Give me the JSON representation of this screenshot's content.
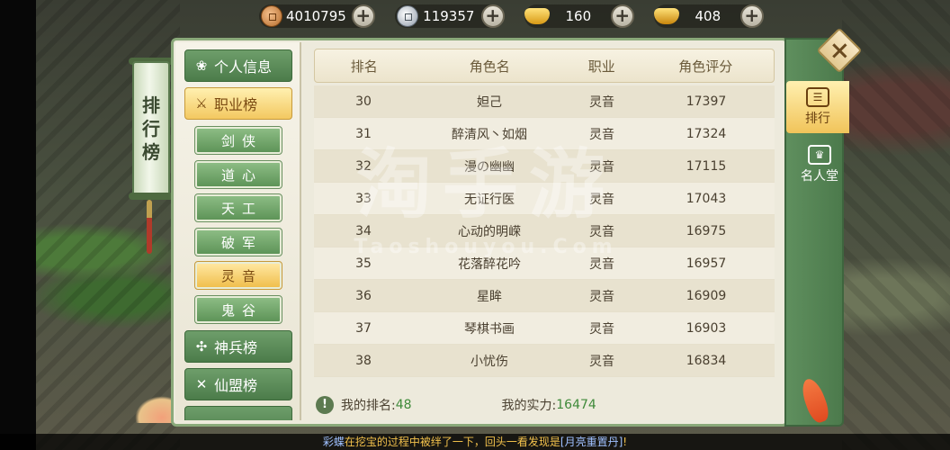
{
  "currencies": [
    {
      "name": "copper-coin",
      "value": "4010795"
    },
    {
      "name": "silver-coin",
      "value": "119357"
    },
    {
      "name": "gold-ingot",
      "value": "160"
    },
    {
      "name": "bound-gold",
      "value": "408"
    }
  ],
  "title": {
    "chars": [
      "排",
      "行",
      "榜"
    ]
  },
  "categories": [
    {
      "label": "个人信息",
      "icon": "lotus-icon"
    },
    {
      "label": "职业榜",
      "icon": "sword-icon"
    },
    {
      "label": "神兵榜",
      "icon": "weapon-icon"
    },
    {
      "label": "仙盟榜",
      "icon": "banner-icon"
    }
  ],
  "professions": [
    "剑侠",
    "道心",
    "天工",
    "破军",
    "灵音",
    "鬼谷"
  ],
  "table": {
    "headers": [
      "排名",
      "角色名",
      "职业",
      "角色评分"
    ],
    "rows": [
      [
        "30",
        "妲己",
        "灵音",
        "17397"
      ],
      [
        "31",
        "醉清风丶如烟",
        "灵音",
        "17324"
      ],
      [
        "32",
        "漫の幽幽",
        "灵音",
        "17115"
      ],
      [
        "33",
        "无证行医",
        "灵音",
        "17043"
      ],
      [
        "34",
        "心动的明嵘",
        "灵音",
        "16975"
      ],
      [
        "35",
        "花落醉花吟",
        "灵音",
        "16957"
      ],
      [
        "36",
        "星眸",
        "灵音",
        "16909"
      ],
      [
        "37",
        "琴棋书画",
        "灵音",
        "16903"
      ],
      [
        "38",
        "小忧伤",
        "灵音",
        "16834"
      ]
    ]
  },
  "footer": {
    "my_rank_label": "我的排名:",
    "my_rank": "48",
    "my_power_label": "我的实力:",
    "my_power": "16474"
  },
  "right_tabs": [
    {
      "label": "排行",
      "icon": "ranking-icon"
    },
    {
      "label": "名人堂",
      "icon": "hall-of-fame-icon"
    }
  ],
  "watermark": {
    "main": "淘手游",
    "sub": "Taoshouyou.Com"
  },
  "ticker": {
    "prefix": "彩蝶",
    "text": "在挖宝的过程中被绊了一下，回头一看发现是",
    "item": "[月亮重置丹]",
    "suffix": "!"
  }
}
